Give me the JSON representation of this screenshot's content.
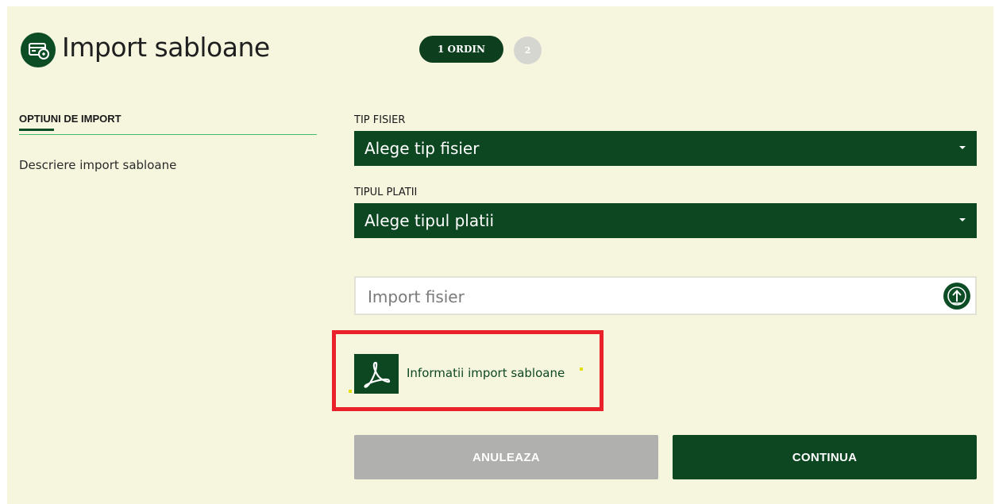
{
  "colors": {
    "brand_dark_green": "#0d4721",
    "accent_green": "#3fb96a",
    "panel_bg": "#f6f6df",
    "highlight_red": "#e8212b",
    "disabled_gray": "#b0b0ae"
  },
  "header": {
    "title": "Import sabloane",
    "icon": "payment-card-icon",
    "steps": [
      {
        "label": "1 ORDIN",
        "state": "active"
      },
      {
        "label": "2",
        "state": "inactive"
      }
    ]
  },
  "sidebar": {
    "tab_label": "OPTIUNI DE IMPORT",
    "description": "Descriere import sabloane"
  },
  "form": {
    "file_type": {
      "label": "TIP FISIER",
      "value": "Alege tip fisier"
    },
    "payment_type": {
      "label": "TIPUL PLATII",
      "value": "Alege tipul platii"
    },
    "file_input": {
      "placeholder": "Import fisier",
      "icon": "upload-icon"
    },
    "info_link": {
      "label": "Informatii import sabloane",
      "icon": "pdf-icon"
    }
  },
  "actions": {
    "cancel_label": "ANULEAZA",
    "continue_label": "CONTINUA"
  }
}
